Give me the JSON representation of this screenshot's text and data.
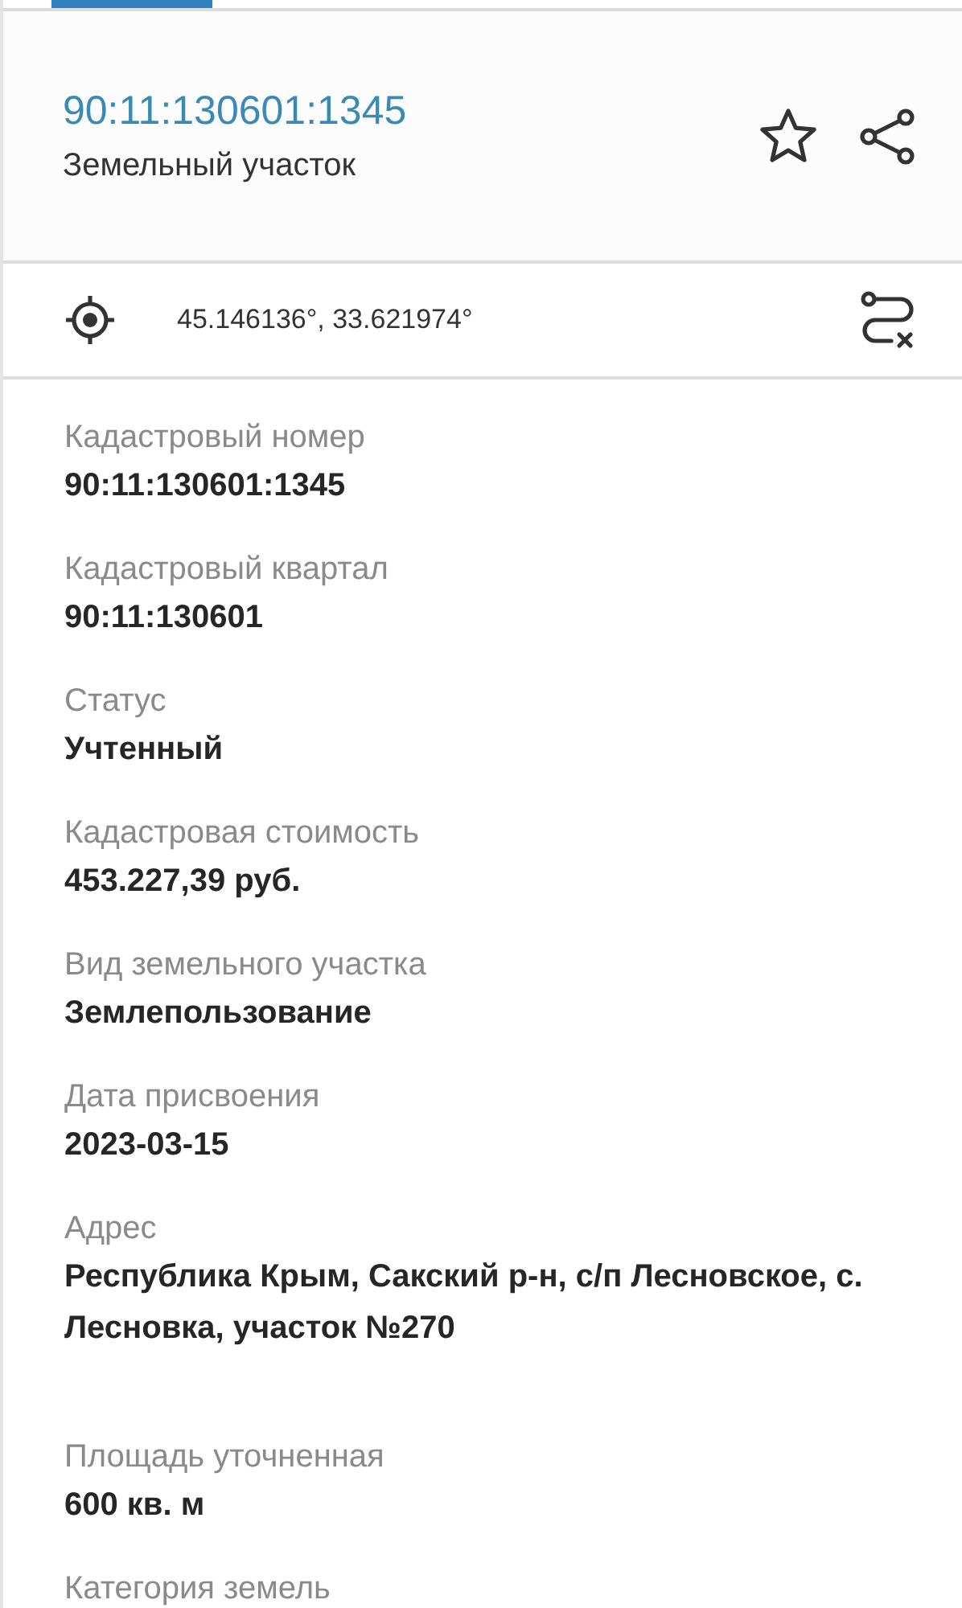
{
  "header": {
    "title": "90:11:130601:1345",
    "subtitle": "Земельный участок"
  },
  "location": {
    "coordinates": "45.146136°, 33.621974°"
  },
  "fields": [
    {
      "label": "Кадастровый номер",
      "value": "90:11:130601:1345"
    },
    {
      "label": "Кадастровый квартал",
      "value": "90:11:130601"
    },
    {
      "label": "Статус",
      "value": "Учтенный"
    },
    {
      "label": "Кадастровая стоимость",
      "value": "453.227,39 руб."
    },
    {
      "label": "Вид земельного участка",
      "value": "Землепользование"
    },
    {
      "label": "Дата присвоения",
      "value": "2023-03-15"
    },
    {
      "label": "Адрес",
      "value": "Республика Крым, Сакский р-н, с/п Лесновское, с. Лесновка, участок №270"
    },
    {
      "label": "Площадь уточненная",
      "value": "600 кв. м"
    },
    {
      "label": "Категория земель"
    }
  ]
}
